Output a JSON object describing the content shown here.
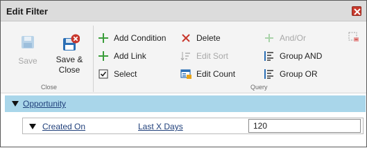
{
  "window": {
    "title": "Edit Filter",
    "close_icon": "close-icon"
  },
  "ribbon": {
    "close_group": {
      "label": "Close",
      "save_label": "Save",
      "save_close_label_line1": "Save &",
      "save_close_label_line2": "Close"
    },
    "query_group": {
      "label": "Query",
      "add_condition": "Add Condition",
      "add_link": "Add Link",
      "select": "Select",
      "delete": "Delete",
      "edit_sort": "Edit Sort",
      "edit_count": "Edit Count",
      "and_or": "And/Or",
      "group_and": "Group AND",
      "group_or": "Group OR"
    }
  },
  "filter": {
    "entity": "Opportunity",
    "condition": {
      "field": "Created On",
      "operator": "Last X Days",
      "value": "120"
    }
  },
  "colors": {
    "accent_green": "#3a9d3a",
    "delete_red": "#c8362b",
    "entity_row_bg": "#a9d6ea",
    "icon_blue": "#2b6fb5"
  }
}
